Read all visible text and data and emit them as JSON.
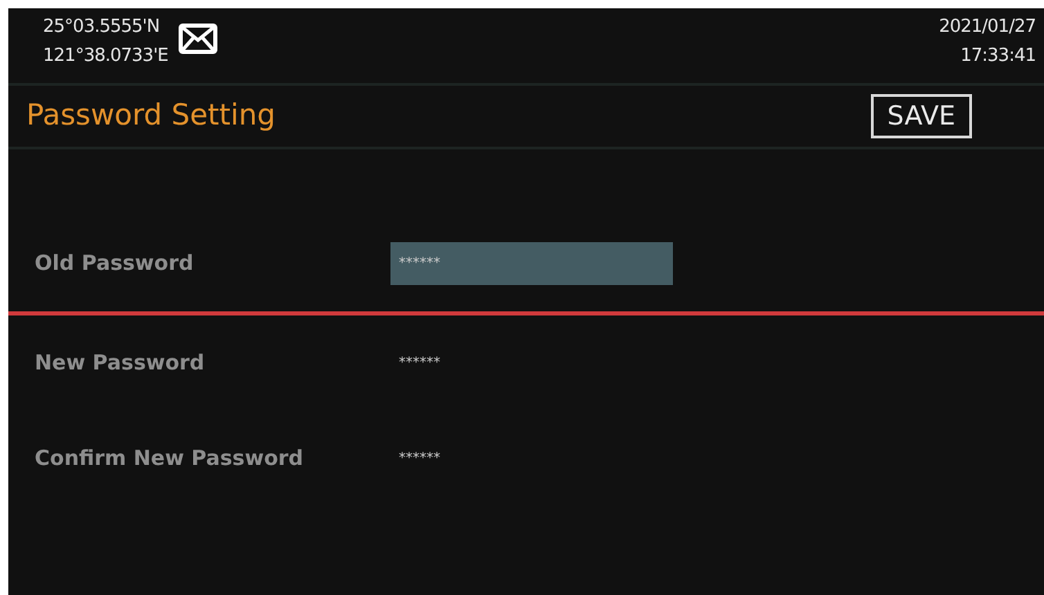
{
  "status_bar": {
    "latitude": "25°03.5555'N",
    "longitude": "121°38.0733'E",
    "date": "2021/01/27",
    "time": "17:33:41"
  },
  "title": "Password Setting",
  "save_button": "SAVE",
  "fields": [
    {
      "label": "Old Password",
      "value": "******",
      "selected": true
    },
    {
      "label": "New Password",
      "value": "******",
      "selected": false
    },
    {
      "label": "Confirm New Password",
      "value": "******",
      "selected": false
    }
  ]
}
